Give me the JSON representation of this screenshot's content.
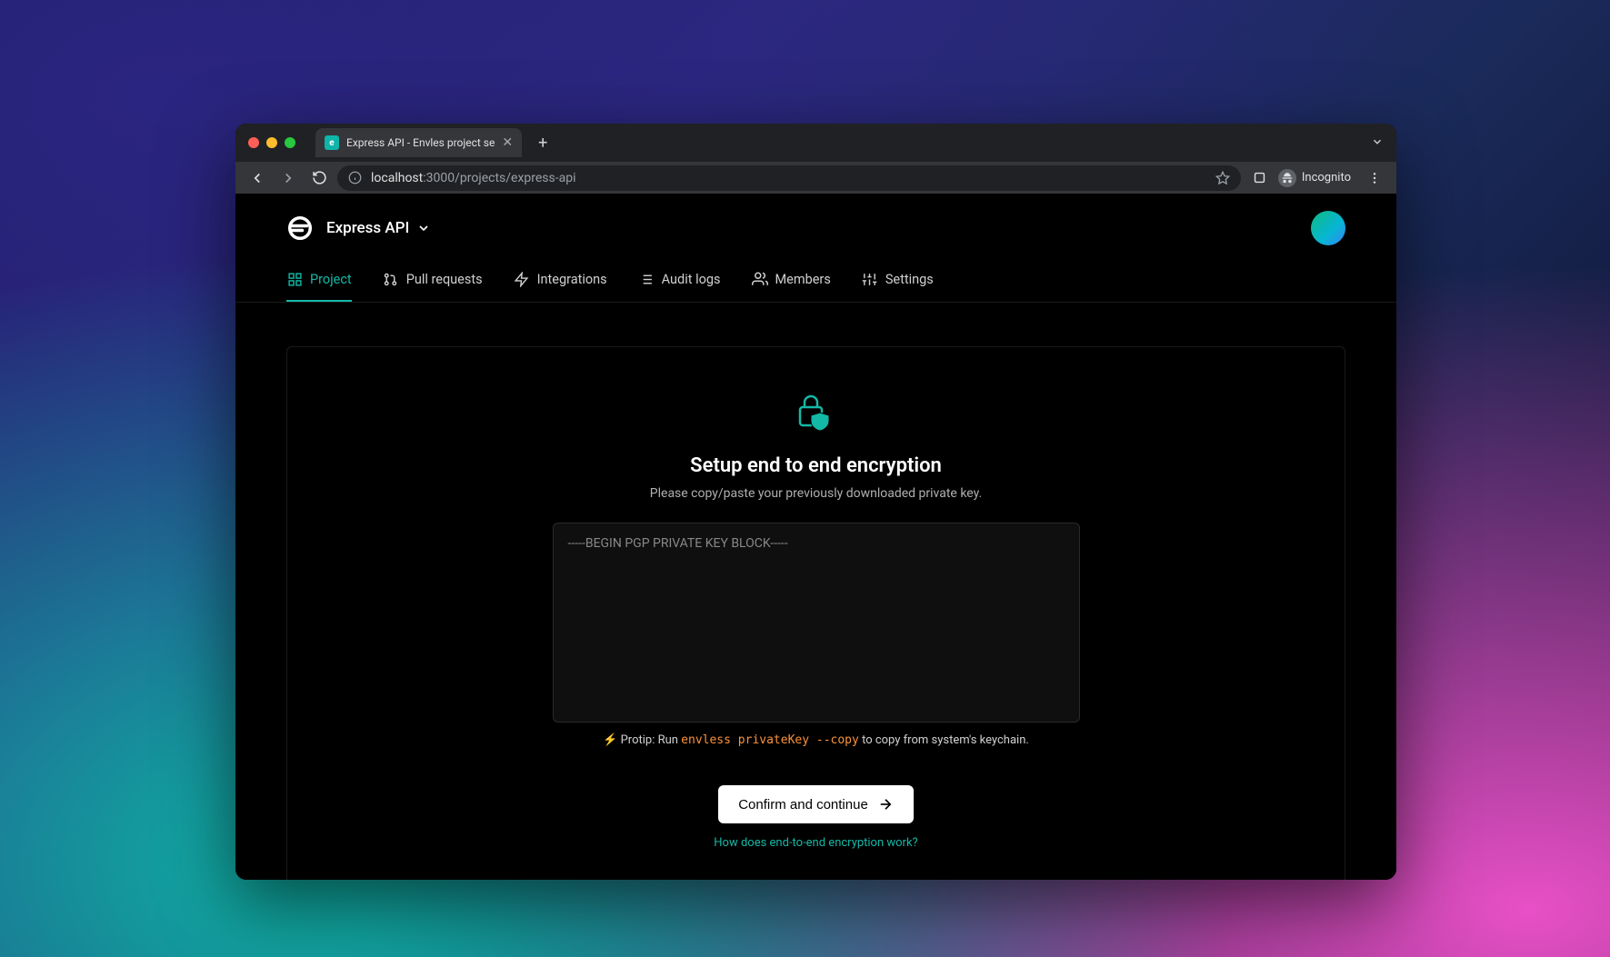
{
  "browser": {
    "tab_title": "Express API - Envles project se",
    "url_host": "localhost",
    "url_port": ":3000",
    "url_path": "/projects/express-api",
    "incognito_label": "Incognito"
  },
  "header": {
    "project_name": "Express API"
  },
  "nav": {
    "items": [
      {
        "label": "Project",
        "icon": "grid-icon",
        "active": true
      },
      {
        "label": "Pull requests",
        "icon": "pull-request-icon",
        "active": false
      },
      {
        "label": "Integrations",
        "icon": "bolt-icon",
        "active": false
      },
      {
        "label": "Audit logs",
        "icon": "list-icon",
        "active": false
      },
      {
        "label": "Members",
        "icon": "users-icon",
        "active": false
      },
      {
        "label": "Settings",
        "icon": "sliders-icon",
        "active": false
      }
    ]
  },
  "card": {
    "title": "Setup end to end encryption",
    "subtitle": "Please copy/paste your previously downloaded private key.",
    "textarea_placeholder": "-----BEGIN PGP PRIVATE KEY BLOCK-----",
    "protip_prefix": "Protip: Run",
    "protip_command": "envless privateKey --copy",
    "protip_suffix": "to copy from system's keychain.",
    "confirm_label": "Confirm and continue",
    "help_link": "How does end-to-end encryption work?"
  },
  "colors": {
    "accent": "#14b8a6",
    "command": "#fb923c"
  }
}
